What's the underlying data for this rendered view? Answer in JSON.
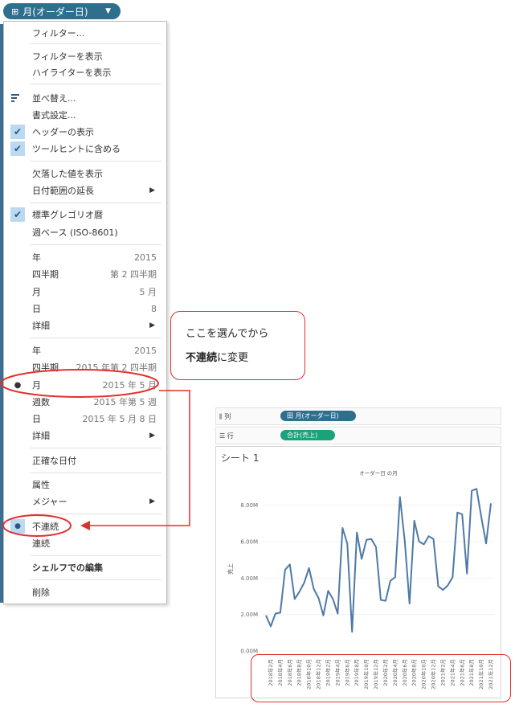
{
  "top_pill": {
    "icon": "calendar-grid-icon",
    "label": "月(オーダー日)",
    "dropdown_icon": "caret-down-icon"
  },
  "menu": {
    "filter": "フィルター...",
    "show_filter": "フィルターを表示",
    "show_highlighter": "ハイライターを表示",
    "sort": "並べ替え...",
    "format": "書式設定...",
    "show_header": "ヘッダーの表示",
    "include_tooltip": "ツールヒントに含める",
    "show_missing": "欠落した値を表示",
    "extend_date_range": "日付範囲の延長",
    "gregorian": "標準グレゴリオ暦",
    "iso_week": "週ベース (ISO-8601)",
    "parts": [
      {
        "label": "年",
        "value": "2015"
      },
      {
        "label": "四半期",
        "value": "第 2 四半期"
      },
      {
        "label": "月",
        "value": "5 月"
      },
      {
        "label": "日",
        "value": "8"
      },
      {
        "label": "詳細",
        "value": ""
      }
    ],
    "truncated": [
      {
        "label": "年",
        "value": "2015"
      },
      {
        "label": "四半期",
        "value": "2015 年第 2 四半期"
      },
      {
        "label": "月",
        "value": "2015 年 5 月"
      },
      {
        "label": "週数",
        "value": "2015 年第 5 週"
      },
      {
        "label": "日",
        "value": "2015 年 5 月 8 日"
      },
      {
        "label": "詳細",
        "value": ""
      }
    ],
    "exact_date": "正確な日付",
    "attribute": "属性",
    "measure": "メジャー",
    "discrete": "不連続",
    "continuous": "連続",
    "edit_in_shelf": "シェルフでの編集",
    "remove": "削除"
  },
  "callout": {
    "line1": "ここを選んでから",
    "line2_bold": "不連続",
    "line2_rest": "に変更"
  },
  "shelf": {
    "columns_label": "列",
    "columns_pill": "田 月(オーダー日)",
    "columns_color": "#2e6f8e",
    "rows_label": "行",
    "rows_pill": "合計(売上)",
    "rows_color": "#1aa37a"
  },
  "sheet_title": "シート 1",
  "chart_data": {
    "type": "line",
    "title": "オーダー日 の月",
    "ylabel": "売上",
    "ylim": [
      0,
      9000000
    ],
    "yticks": [
      "0.00M",
      "2.00M",
      "4.00M",
      "6.00M",
      "8.00M"
    ],
    "ytick_values": [
      0,
      2000000,
      4000000,
      6000000,
      8000000
    ],
    "line_color": "#4e79a7",
    "x_tick_labels": [
      "2018年2月",
      "2018年4月",
      "2018年6月",
      "2018年8月",
      "2018年10月",
      "2018年12月",
      "2019年2月",
      "2019年4月",
      "2019年6月",
      "2019年8月",
      "2019年10月",
      "2019年12月",
      "2020年2月",
      "2020年4月",
      "2020年6月",
      "2020年8月",
      "2020年10月",
      "2020年12月",
      "2021年2月",
      "2021年4月",
      "2021年6月",
      "2021年8月",
      "2021年10月",
      "2021年12月"
    ],
    "values": [
      1.95,
      1.35,
      2.05,
      2.1,
      4.45,
      4.75,
      2.85,
      3.25,
      3.75,
      4.55,
      3.4,
      2.9,
      1.95,
      3.3,
      2.85,
      2.05,
      6.75,
      5.9,
      1.05,
      6.5,
      5.05,
      6.1,
      6.15,
      5.7,
      2.8,
      2.75,
      3.85,
      4.05,
      8.45,
      6.05,
      2.6,
      7.15,
      6.0,
      5.85,
      6.3,
      6.15,
      3.55,
      3.35,
      3.6,
      4.05,
      7.6,
      7.5,
      4.25,
      8.8,
      8.9,
      7.35,
      5.9,
      8.1
    ],
    "value_unit_note": "M"
  }
}
